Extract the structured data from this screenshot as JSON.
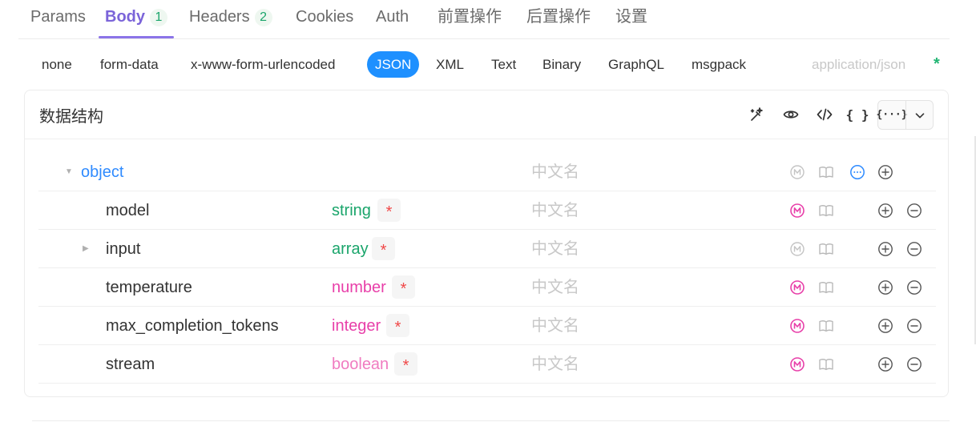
{
  "tabs": [
    {
      "label": "Params",
      "badge": ""
    },
    {
      "label": "Body",
      "badge": "1"
    },
    {
      "label": "Headers",
      "badge": "2"
    },
    {
      "label": "Cookies",
      "badge": ""
    },
    {
      "label": "Auth",
      "badge": ""
    },
    {
      "label": "前置操作",
      "badge": ""
    },
    {
      "label": "后置操作",
      "badge": ""
    },
    {
      "label": "设置",
      "badge": ""
    }
  ],
  "body_types": [
    "none",
    "form-data",
    "x-www-form-urlencoded",
    "JSON",
    "XML",
    "Text",
    "Binary",
    "GraphQL",
    "msgpack"
  ],
  "active_body_type": "JSON",
  "mime": "application/json",
  "mime_required": "*",
  "panel": {
    "title": "数据结构",
    "tools": [
      "magic-wand-icon",
      "eye-icon",
      "code-icon",
      "braces-icon",
      "braces-ellipsis-icon",
      "chevron-down-icon"
    ],
    "braces_label": "{ }",
    "braces_ellipsis_label": "{···}"
  },
  "schema": {
    "root": {
      "name": "object",
      "display_name_placeholder": "中文名"
    },
    "fields": [
      {
        "name": "model",
        "type": "string",
        "required": "*",
        "display_name_placeholder": "中文名",
        "expandable": false,
        "mock_active": true
      },
      {
        "name": "input",
        "type": "array",
        "required": "*",
        "display_name_placeholder": "中文名",
        "expandable": true,
        "mock_active": false
      },
      {
        "name": "temperature",
        "type": "number",
        "required": "*",
        "display_name_placeholder": "中文名",
        "expandable": false,
        "mock_active": true
      },
      {
        "name": "max_completion_tokens",
        "type": "integer",
        "required": "*",
        "display_name_placeholder": "中文名",
        "expandable": false,
        "mock_active": true
      },
      {
        "name": "stream",
        "type": "boolean",
        "required": "*",
        "display_name_placeholder": "中文名",
        "expandable": false,
        "mock_active": true
      }
    ]
  },
  "colors": {
    "accent": "#7b64d9",
    "json_active": "#1e90ff",
    "object": "#2f8bff",
    "type_green": "#1aa56b",
    "type_pink": "#e83fa9",
    "required_red": "#f04848",
    "mock_pink": "#e83fa9",
    "mock_grey": "#c4c4c4"
  }
}
